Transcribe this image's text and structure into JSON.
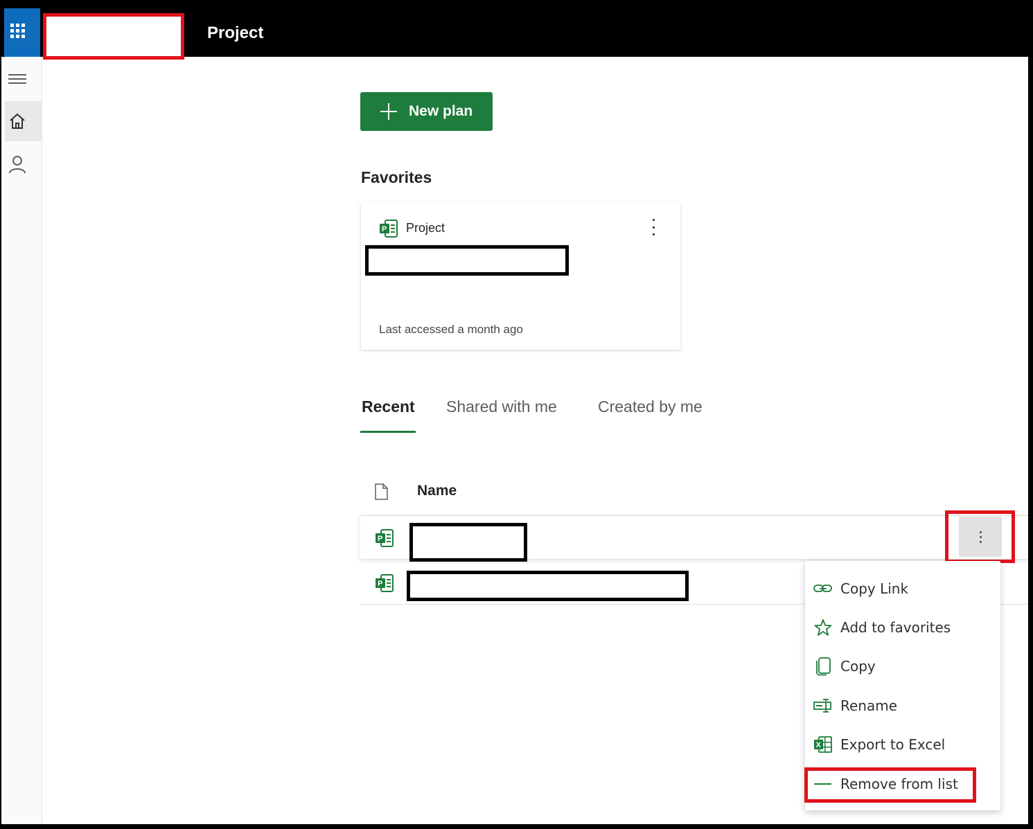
{
  "header": {
    "app_title": "Project"
  },
  "actions": {
    "new_plan_label": "New plan"
  },
  "favorites": {
    "title": "Favorites",
    "card": {
      "type_label": "Project",
      "meta": "Last accessed a month ago"
    }
  },
  "tabs": [
    {
      "label": "Recent",
      "active": true
    },
    {
      "label": "Shared with me",
      "active": false
    },
    {
      "label": "Created by me",
      "active": false
    }
  ],
  "list": {
    "column_name": "Name"
  },
  "context_menu": {
    "items": [
      {
        "label": "Copy Link",
        "icon": "link-icon"
      },
      {
        "label": "Add to favorites",
        "icon": "star-icon"
      },
      {
        "label": "Copy",
        "icon": "copy-icon"
      },
      {
        "label": "Rename",
        "icon": "rename-icon"
      },
      {
        "label": "Export to Excel",
        "icon": "excel-icon"
      },
      {
        "label": "Remove from list",
        "icon": "minus-icon"
      }
    ]
  },
  "colors": {
    "brand_green": "#1e7d3c",
    "waffle_blue": "#0f6cbd",
    "highlight_red": "#e0121b"
  }
}
